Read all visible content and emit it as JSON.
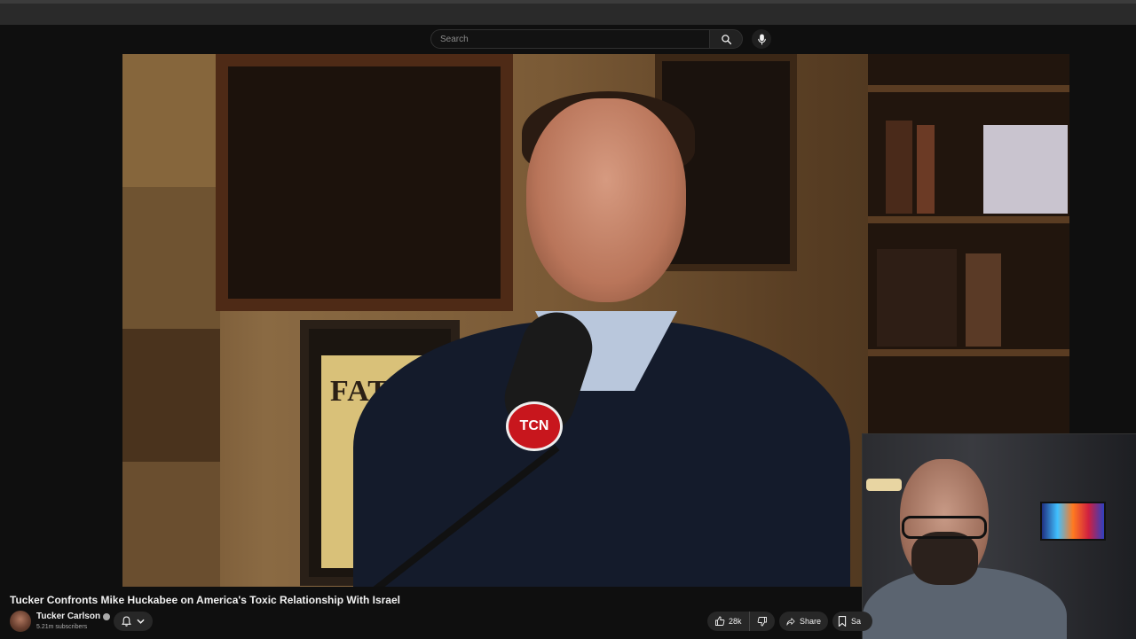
{
  "search": {
    "placeholder": "Search"
  },
  "video": {
    "title": "Tucker Confronts Mike Huckabee on America's Toxic Relationship With Israel",
    "poster_text": "FATIM",
    "mic_logo": "TCN"
  },
  "channel": {
    "name": "Tucker Carlson",
    "subscribers": "5.21m subscribers"
  },
  "actions": {
    "like_count": "28k",
    "share_label": "Share",
    "save_label": "Sa"
  },
  "icons": {
    "search": "search-icon",
    "mic": "mic-icon",
    "bell": "bell-icon",
    "chevron": "chevron-down-icon",
    "like": "thumbs-up-icon",
    "dislike": "thumbs-down-icon",
    "share": "share-icon",
    "save": "bookmark-icon",
    "verified": "verified-icon"
  },
  "colors": {
    "background": "#0f0f0f",
    "pill": "#272727",
    "text": "#f1f1f1",
    "secondary_text": "#aaaaaa",
    "brand_logo": "#c8161d"
  }
}
